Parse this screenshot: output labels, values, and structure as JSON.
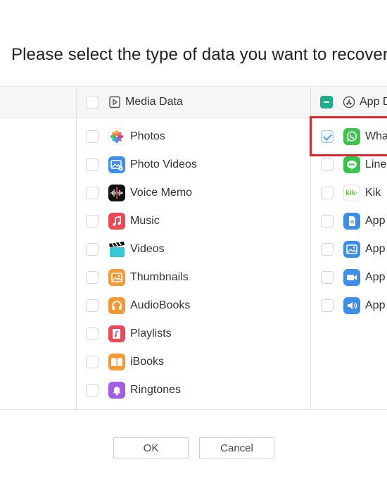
{
  "title": "Please select the type of data you want to recover",
  "media_column": {
    "header": "Media Data",
    "items": [
      {
        "label": "Photos",
        "icon": "photos-icon",
        "checked": false
      },
      {
        "label": "Photo Videos",
        "icon": "photo-videos-icon",
        "checked": false
      },
      {
        "label": "Voice Memo",
        "icon": "voice-memo-icon",
        "checked": false
      },
      {
        "label": "Music",
        "icon": "music-icon",
        "checked": false
      },
      {
        "label": "Videos",
        "icon": "videos-icon",
        "checked": false
      },
      {
        "label": "Thumbnails",
        "icon": "thumbnails-icon",
        "checked": false
      },
      {
        "label": "AudioBooks",
        "icon": "audiobooks-icon",
        "checked": false
      },
      {
        "label": "Playlists",
        "icon": "playlists-icon",
        "checked": false
      },
      {
        "label": "iBooks",
        "icon": "ibooks-icon",
        "checked": false
      },
      {
        "label": "Ringtones",
        "icon": "ringtones-icon",
        "checked": false
      }
    ]
  },
  "app_column": {
    "header": "App D",
    "header_state": "partial",
    "items": [
      {
        "label": "Wha",
        "icon": "whatsapp-icon",
        "checked": true
      },
      {
        "label": "Line",
        "icon": "line-icon",
        "checked": false
      },
      {
        "label": "Kik",
        "icon": "kik-icon",
        "icon_text": "kik·",
        "checked": false
      },
      {
        "label": "App",
        "icon": "app-document-icon",
        "checked": false
      },
      {
        "label": "App",
        "icon": "app-photo-icon",
        "checked": false
      },
      {
        "label": "App",
        "icon": "app-video-icon",
        "checked": false
      },
      {
        "label": "App",
        "icon": "app-audio-icon",
        "checked": false
      }
    ]
  },
  "buttons": {
    "ok": "OK",
    "cancel": "Cancel"
  },
  "colors": {
    "accent": "#1fae8c",
    "highlight": "#e0252b",
    "check": "#5a9bd0"
  }
}
